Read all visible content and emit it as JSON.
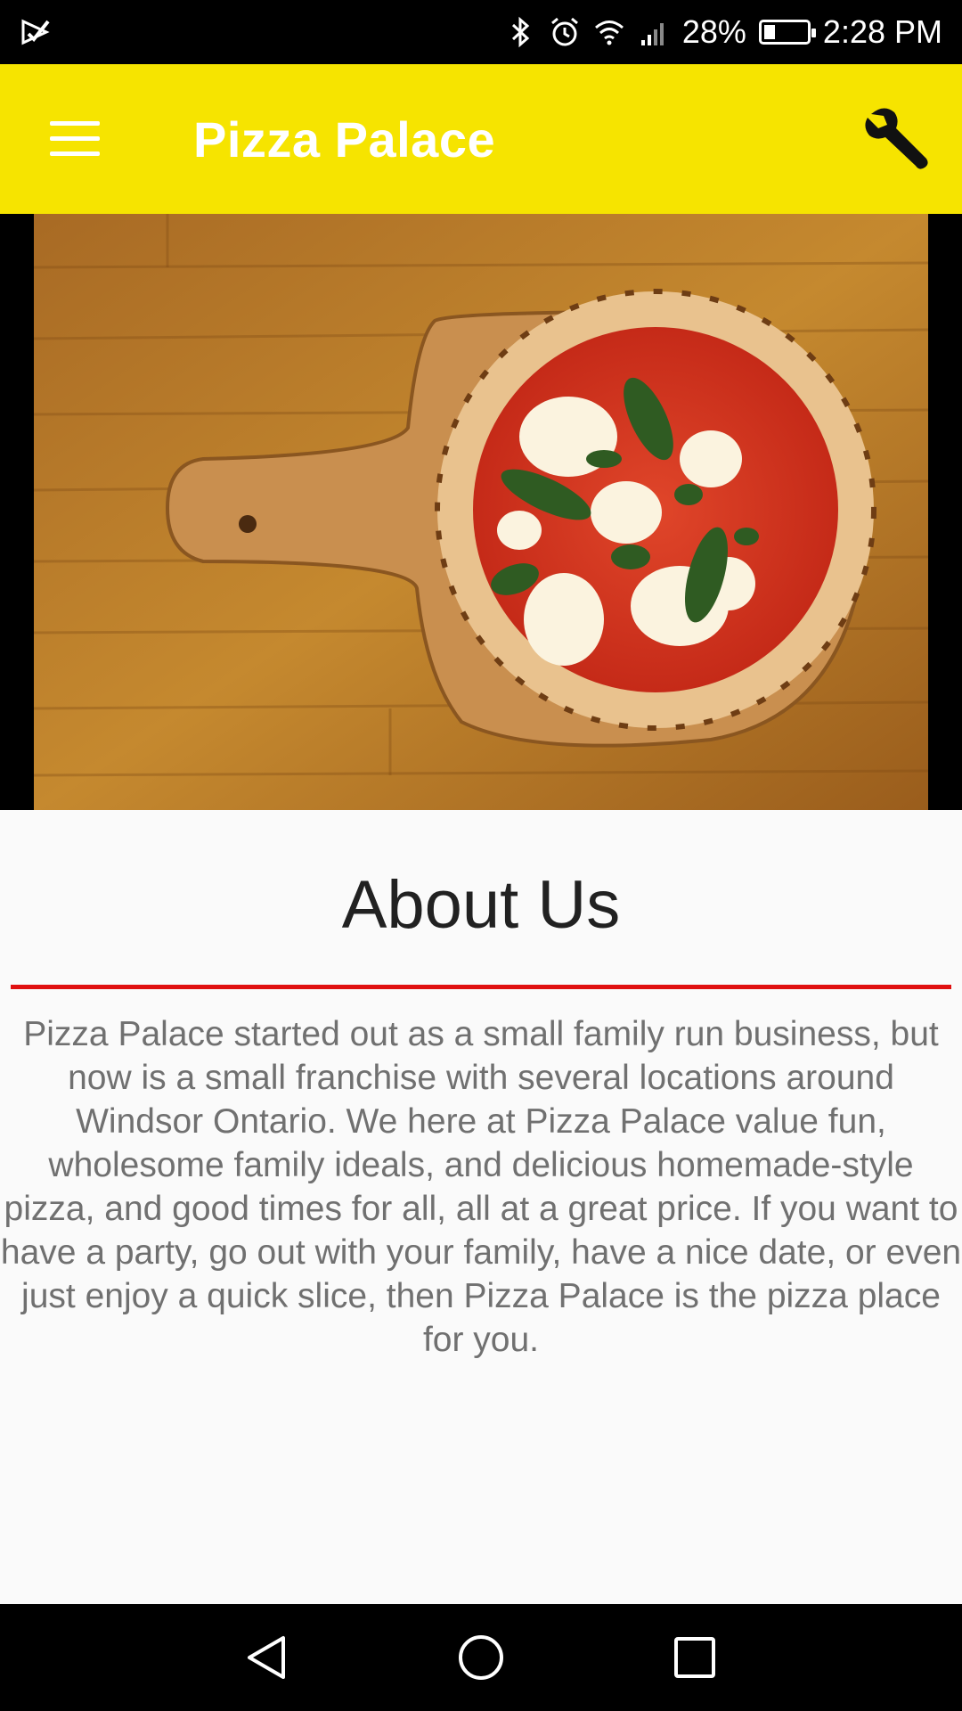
{
  "status_bar": {
    "battery_text": "28%",
    "time": "2:28 PM",
    "battery_level": 0.28,
    "icons": [
      "notification-icon",
      "bluetooth-icon",
      "alarm-icon",
      "wifi-icon",
      "signal-icon",
      "battery-icon"
    ]
  },
  "app_bar": {
    "title": "Pizza Palace",
    "background_color": "#f6e400",
    "menu_icon": "hamburger-menu-icon",
    "action_icon": "wrench-icon"
  },
  "about": {
    "heading": "About Us",
    "divider_color": "#e01010",
    "body": "Pizza Palace started out as a small family run business, but now is a small franchise with several locations around Windsor Ontario. We here at Pizza Palace value fun, wholesome family ideals, and delicious homemade-style pizza, and good times for all, all at a great price. If you want to have a party, go out with your family, have a nice date, or even just enjoy a quick slice, then Pizza Palace is the pizza place for you."
  },
  "nav_bar": {
    "icons": [
      "back-icon",
      "home-icon",
      "recents-icon"
    ]
  }
}
